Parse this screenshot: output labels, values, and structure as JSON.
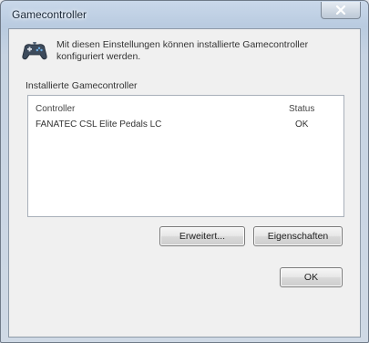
{
  "window": {
    "title": "Gamecontroller",
    "close_symbol": "x"
  },
  "dialog": {
    "description": "Mit diesen Einstellungen können installierte Gamecontroller konfiguriert werden.",
    "group_label": "Installierte Gamecontroller",
    "columns": {
      "controller": "Controller",
      "status": "Status"
    },
    "rows": [
      {
        "name": "FANATEC CSL Elite Pedals LC",
        "status": "OK"
      }
    ]
  },
  "buttons": {
    "advanced": "Erweitert...",
    "properties": "Eigenschaften",
    "ok": "OK"
  },
  "icons": {
    "app_icon": "gamepad-icon",
    "close": "close-icon"
  },
  "colors": {
    "titlebar": "#b9cbe0",
    "client": "#f0f0f0",
    "list_background": "#ffffff"
  }
}
